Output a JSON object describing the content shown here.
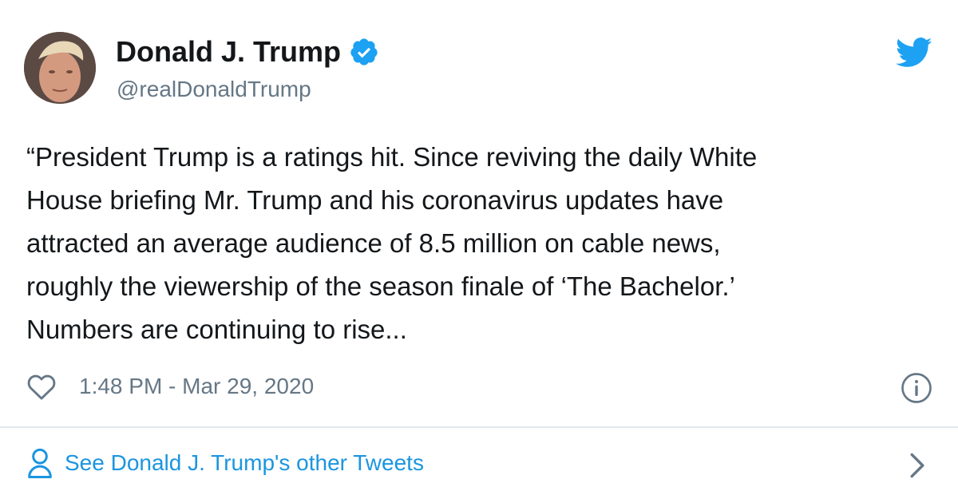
{
  "author": {
    "name": "Donald J. Trump",
    "handle": "@realDonaldTrump",
    "avatar_icon": "profile-photo",
    "verified_icon": "verified-badge-icon"
  },
  "brand": {
    "logo_icon": "twitter-bird-icon",
    "accent_color": "#1da1f2"
  },
  "tweet": {
    "text": "“President Trump is a ratings hit. Since reviving the daily White\nHouse briefing Mr. Trump and his coronavirus updates have\nattracted an average audience of 8.5 million on cable news,\nroughly the viewership of the season finale of ‘The Bachelor.’\nNumbers are continuing to rise...",
    "timestamp": "1:48 PM - Mar 29, 2020"
  },
  "actions": {
    "like_icon": "heart-icon",
    "info_icon": "info-icon"
  },
  "footer": {
    "link_label": "See Donald J. Trump's other Tweets",
    "link_color": "#1b95e0",
    "person_icon": "person-icon",
    "chevron_icon": "chevron-right-icon"
  }
}
